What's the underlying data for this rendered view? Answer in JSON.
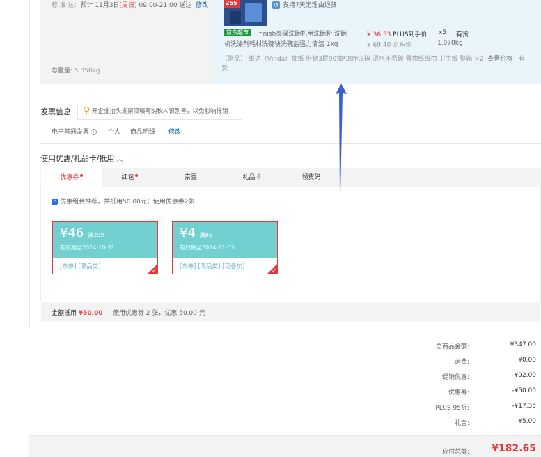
{
  "delivery": {
    "label": "标 准 达:",
    "text": "预计 11月3日",
    "weekday": "[周日]",
    "time": "09:00-21:00 送达",
    "modify": "修改"
  },
  "total_weight": {
    "label": "总重量:",
    "value": "5.350kg"
  },
  "product": {
    "thumb_text": "255",
    "support": "支持7天无理由退货",
    "store_badge": "京东超市",
    "name_line1": "finish亮碟洗碗机用洗碗粉 洗碗",
    "name_line2": "机洗涤剂耗材洗碗块洗碗盐强力清洁 1kg",
    "price": "¥ 36.53",
    "price_tag": "PLUS到手价",
    "orig_price": "¥ 69.40 京东价",
    "qty": "x5",
    "stock": "有货",
    "weight": "1.070kg",
    "gift_line1_prefix": "【赠品】 维达（Vinda）抽纸 倍韧3层90抽*20包S码 湿水不易破 餐巾纸纸巾 卫生纸 整箱 ×2",
    "gift_link": "查看价格",
    "gift_stock_1": "有",
    "gift_stock_2": "货"
  },
  "invoice": {
    "title": "发票信息",
    "tip": "开企业抬头发票须填写纳税人识别号，以免影响报销",
    "type": "电子普通发票",
    "info_icon": "i",
    "person": "个人",
    "detail": "商品明细",
    "modify": "修改"
  },
  "coupons": {
    "title": "使用优惠/礼品卡/抵用",
    "chevron": "︿",
    "tabs": [
      {
        "label": "优惠券",
        "dot": true
      },
      {
        "label": "红包",
        "dot": true
      },
      {
        "label": "京豆",
        "dot": false
      },
      {
        "label": "礼品卡",
        "dot": false
      },
      {
        "label": "领货码",
        "dot": false
      }
    ],
    "combo_text": "优惠组合推荐，共抵用50.00元；使用优惠券2张",
    "items": [
      {
        "amount": "¥46",
        "cond": "满299",
        "expiry": "有效期至2024-10-31",
        "tags": "[东券] [限品类]"
      },
      {
        "amount": "¥4",
        "cond": "满85",
        "expiry": "有效期至2024-11-03",
        "tags": "[东券] [限品类] [可叠加]"
      }
    ],
    "footer_label": "金额抵用",
    "footer_amount": "¥50.00",
    "footer_text": "使用优惠券 2 张，优惠 50.00 元"
  },
  "summary": [
    {
      "label": "总商品金额:",
      "value": "¥347.00"
    },
    {
      "label": "运费:",
      "value": "¥0.00"
    },
    {
      "label": "促销优惠:",
      "value": "-¥92.00"
    },
    {
      "label": "优惠券:",
      "value": "-¥50.00"
    },
    {
      "label": "PLUS 95折:",
      "value": "-¥17.35"
    },
    {
      "label": "礼金:",
      "value": "¥5.00"
    }
  ],
  "total": {
    "label": "应付总额:",
    "value": "¥182.65"
  },
  "colors": {
    "accent": "#e4393c",
    "link": "#005ea7",
    "coupon": "#72d0d0",
    "arrow": "#3b5fd6"
  }
}
